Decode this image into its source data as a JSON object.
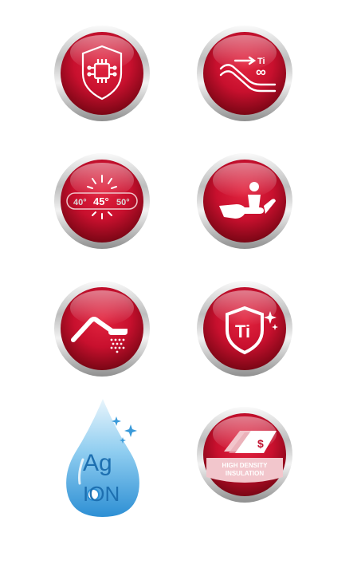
{
  "colors": {
    "badge_red": "#c8102e",
    "badge_dark_red": "#7a0615",
    "chrome": "#c9c9c9",
    "drop_blue": "#3a9ad9"
  },
  "badges": [
    {
      "icon": "processor-shield-icon"
    },
    {
      "icon": "titanium-infinity-icon",
      "label_ti": "Ti",
      "label_inf": "∞"
    },
    {
      "icon": "temperature-scale-icon",
      "temps": [
        "40°",
        "45°",
        "50°"
      ]
    },
    {
      "icon": "hand-care-icon"
    },
    {
      "icon": "rain-shower-icon"
    },
    {
      "icon": "titanium-shield-icon",
      "label_ti": "Ti"
    },
    {
      "icon": "ag-ion-drop-icon",
      "label_ag": "Ag",
      "label_ion": "ION"
    },
    {
      "icon": "high-density-insulation-icon",
      "label_line1": "HIGH DENSITY",
      "label_line2": "INSULATION",
      "currency": "$"
    }
  ]
}
